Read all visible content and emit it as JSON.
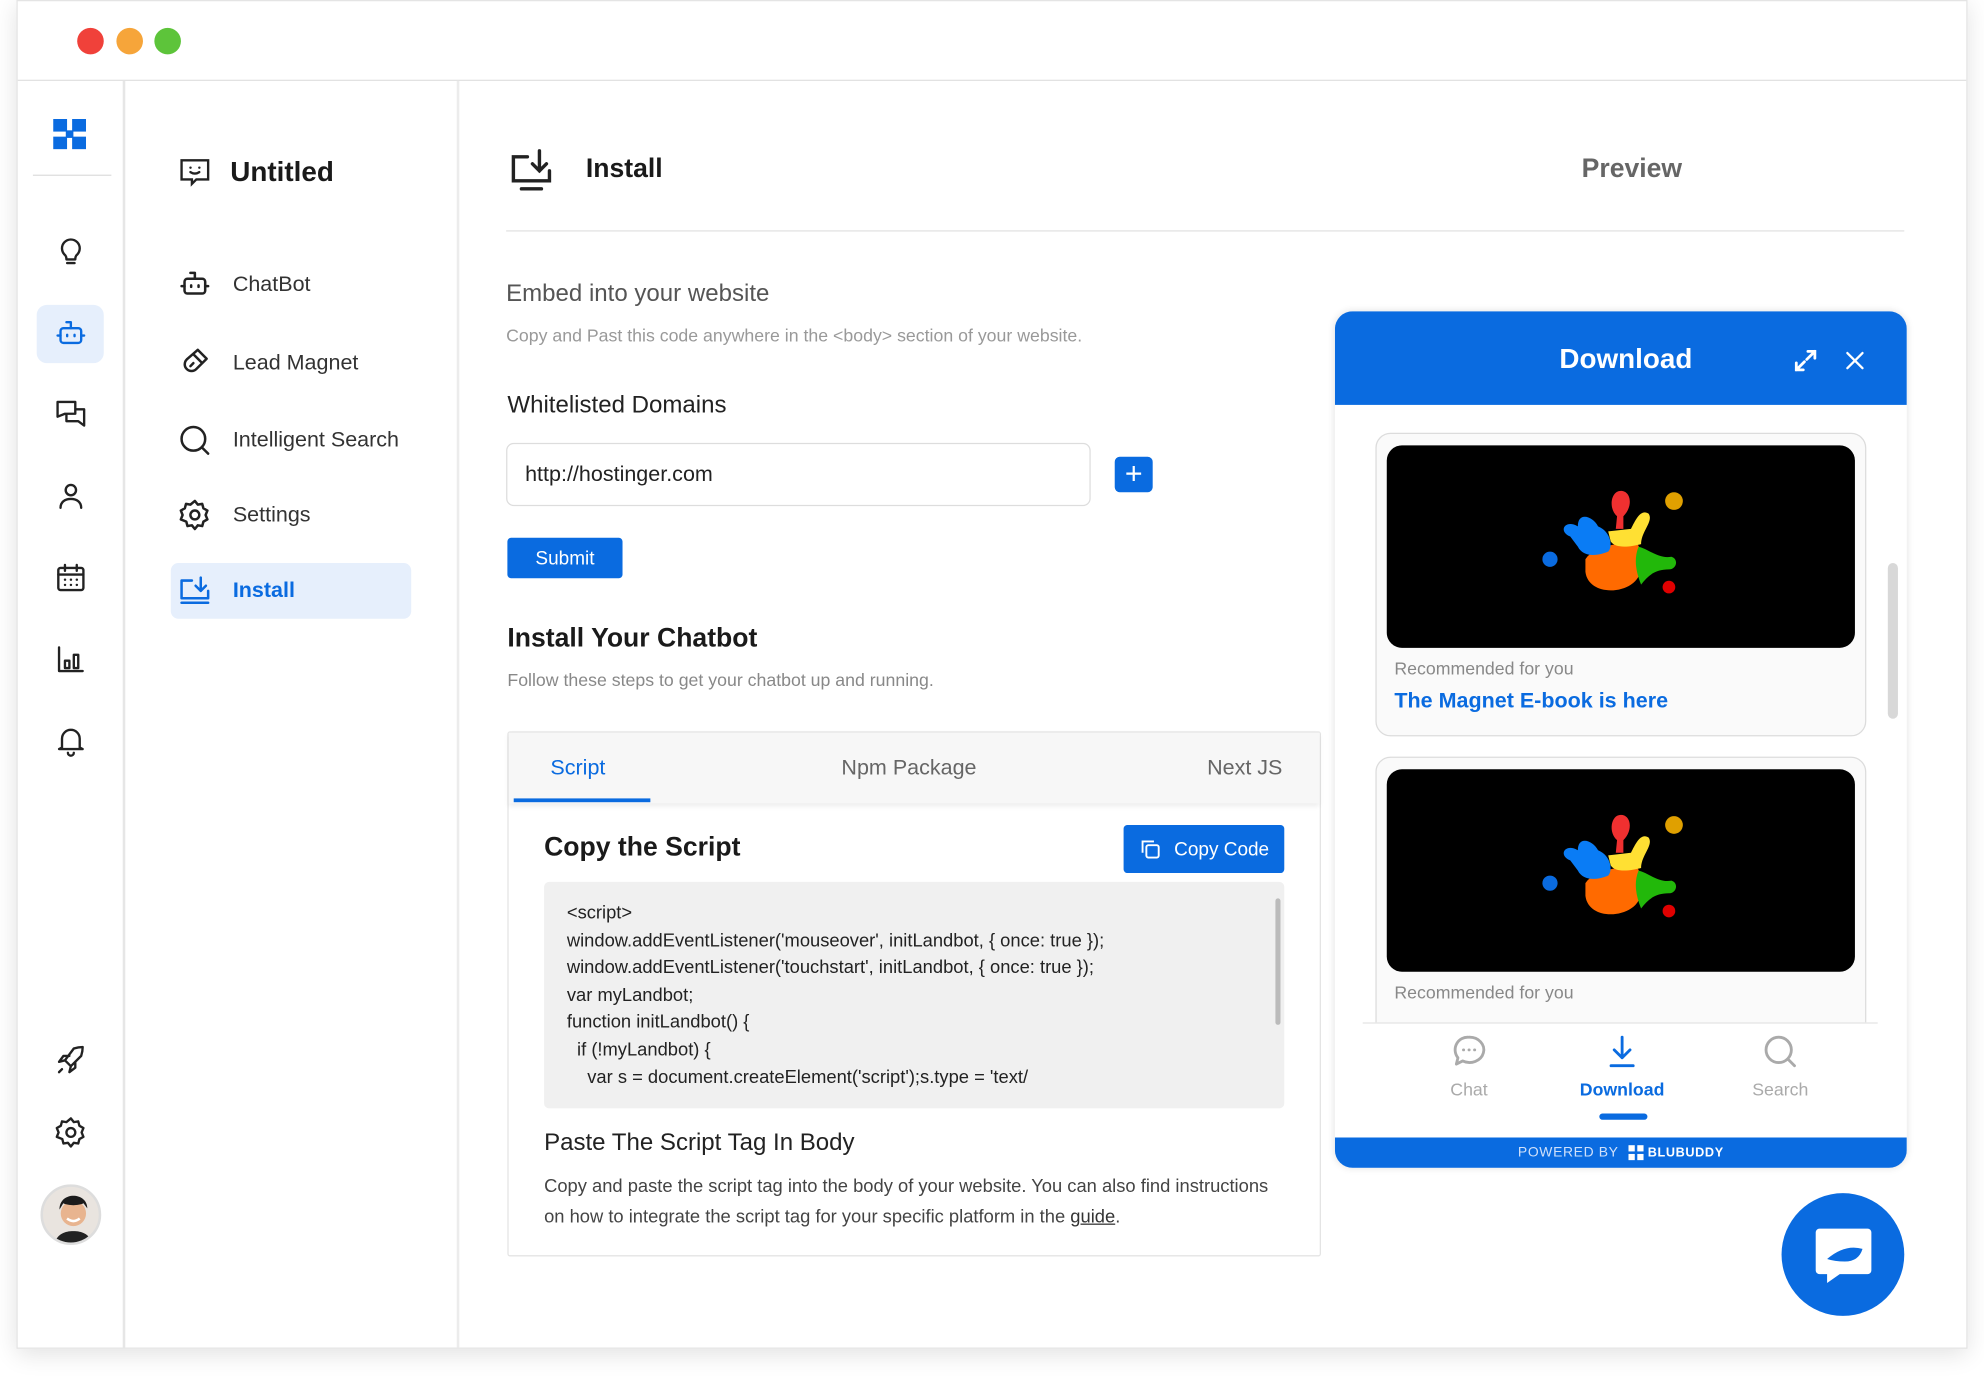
{
  "window": {
    "controls": [
      "close",
      "minimize",
      "maximize"
    ]
  },
  "rail": {
    "items": [
      {
        "icon": "lightbulb-icon"
      },
      {
        "icon": "robot-icon",
        "active": true
      },
      {
        "icon": "chat-bubbles-icon"
      },
      {
        "icon": "user-icon"
      },
      {
        "icon": "calendar-icon"
      },
      {
        "icon": "bar-chart-icon"
      },
      {
        "icon": "bell-icon"
      }
    ],
    "bottom": [
      {
        "icon": "rocket-icon"
      },
      {
        "icon": "gear-icon"
      },
      {
        "icon": "avatar"
      }
    ]
  },
  "sidebar": {
    "title": "Untitled",
    "items": [
      {
        "label": "ChatBot",
        "icon": "robot-icon"
      },
      {
        "label": "Lead Magnet",
        "icon": "magnet-icon"
      },
      {
        "label": "Intelligent Search",
        "icon": "search-icon"
      },
      {
        "label": "Settings",
        "icon": "gear-icon"
      },
      {
        "label": "Install",
        "icon": "install-icon",
        "active": true
      }
    ]
  },
  "header": {
    "title": "Install",
    "preview": "Preview"
  },
  "embed": {
    "title": "Embed into your website",
    "subtitle": "Copy and Past this code anywhere in the <body> section of your website."
  },
  "whitelist": {
    "label": "Whitelisted Domains",
    "value": "http://hostinger.com",
    "submit": "Submit"
  },
  "install": {
    "title": "Install Your Chatbot",
    "subtitle": "Follow these steps to get your chatbot up and running.",
    "tabs": [
      "Script",
      "Npm Package",
      "Next JS"
    ],
    "active_tab": "Script",
    "copy_title": "Copy the Script",
    "copy_button": "Copy Code",
    "code": "<script>\nwindow.addEventListener('mouseover', initLandbot, { once: true });\nwindow.addEventListener('touchstart', initLandbot, { once: true });\nvar myLandbot;\nfunction initLandbot() {\n  if (!myLandbot) {\n    var s = document.createElement('script');s.type = 'text/",
    "paste_title": "Paste The Script Tag In Body",
    "paste_text": "Copy and paste the script tag into the body of your website. You can also find instructions on how to integrate the script tag for your specific platform in the ",
    "guide_link": "guide",
    "paste_end": "."
  },
  "widget": {
    "title": "Download",
    "cards": [
      {
        "label": "Recommended for you",
        "title": "The Magnet E-book is here"
      },
      {
        "label": "Recommended for you"
      }
    ],
    "nav": [
      {
        "label": "Chat",
        "icon": "chat-icon"
      },
      {
        "label": "Download",
        "icon": "download-icon",
        "active": true
      },
      {
        "label": "Search",
        "icon": "search-icon"
      }
    ],
    "powered_by": "POWERED BY",
    "brand": "BLUBUDDY"
  },
  "colors": {
    "accent": "#0a6be0",
    "active_bg": "#e6effc"
  }
}
